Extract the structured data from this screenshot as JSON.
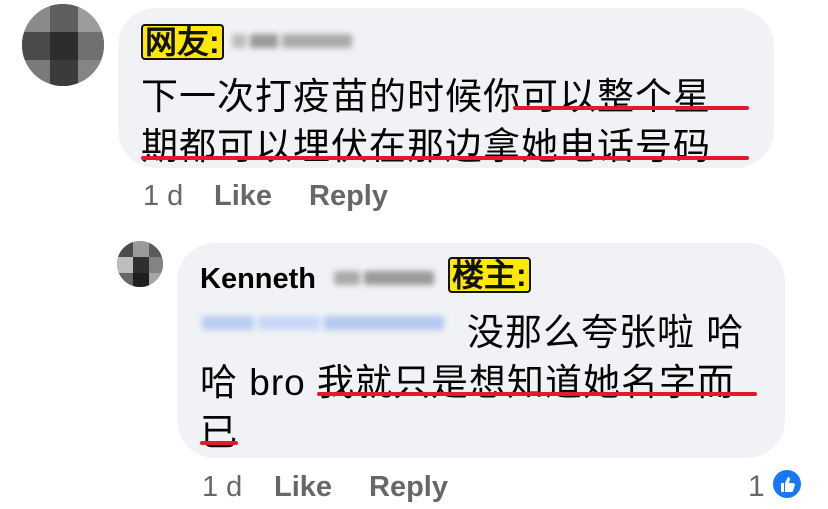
{
  "comment": {
    "label": "网友:",
    "lines": [
      "下一次打疫苗的时候你可以整个星",
      "期都可以埋伏在那边拿她电话号码"
    ],
    "meta": {
      "time": "1 d",
      "like": "Like",
      "reply": "Reply"
    }
  },
  "reply": {
    "author": "Kenneth",
    "label": "楼主:",
    "mention_text": "没那么夸张啦 哈",
    "lines": [
      "哈 bro 我就只是想知道她名字而",
      "已"
    ],
    "meta": {
      "time": "1 d",
      "like": "Like",
      "reply": "Reply"
    },
    "reaction_count": "1"
  },
  "colors": {
    "bubble": "#f0f2f5",
    "underline": "#e31a2e",
    "label_bg": "#ffe900",
    "meta_text": "#65676b",
    "like_blue": "#1877f2"
  },
  "icons": [
    "pixelated-avatar",
    "thumbs-up-icon"
  ]
}
